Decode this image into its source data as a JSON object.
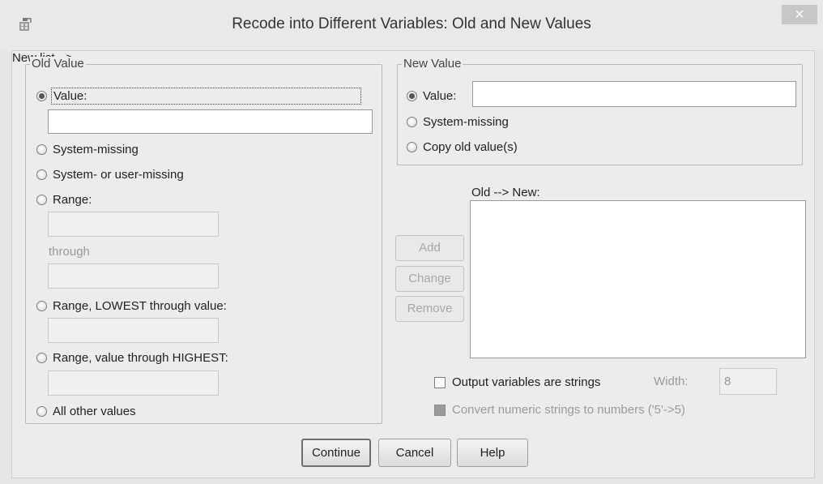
{
  "window": {
    "title": "Recode into Different Variables: Old and New Values",
    "close_label": "×",
    "app_icon": "spss-icon"
  },
  "old_value": {
    "legend": "Old Value",
    "value_label": "Value:",
    "value_text": "",
    "system_missing_label": "System-missing",
    "sys_user_missing_label": "System- or user-missing",
    "range_label": "Range:",
    "range_from": "",
    "through_label": "through",
    "range_to": "",
    "range_lowest_label": "Range, LOWEST through value:",
    "range_lowest_value": "",
    "range_highest_label": "Range, value through HIGHEST:",
    "range_highest_value": "",
    "all_other_label": "All other values",
    "selected": "Value:"
  },
  "new_value": {
    "legend": "New Value",
    "value_label": "Value:",
    "value_text": "",
    "system_missing_label": "System-missing",
    "copy_old_label": "Copy old value(s)",
    "selected": "Value:"
  },
  "mapping": {
    "list_label": "Old --> New:",
    "items": [],
    "add_label": "Add",
    "change_label": "Change",
    "remove_label": "Remove"
  },
  "options": {
    "output_strings_label": "Output variables are strings",
    "output_strings_checked": false,
    "width_label": "Width:",
    "width_value": "8",
    "convert_label": "Convert numeric strings to numbers ('5'->5)",
    "convert_checked": false
  },
  "footer": {
    "continue_label": "Continue",
    "cancel_label": "Cancel",
    "help_label": "Help"
  }
}
